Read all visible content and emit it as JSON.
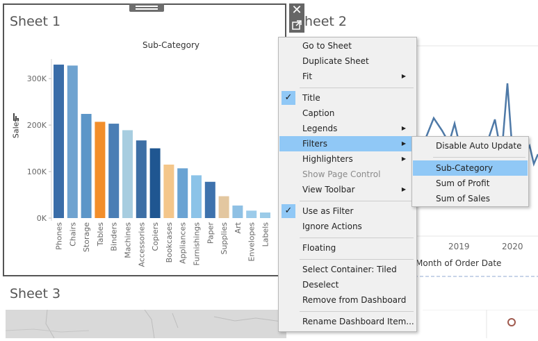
{
  "sheets": {
    "sheet1_title": "Sheet 1",
    "sheet2_title": "Sheet 2",
    "sheet2_title_visible": "heet 2",
    "sheet3_title": "Sheet 3"
  },
  "sheet1_chart": {
    "title": "Sub-Category",
    "ylabel": "Sales"
  },
  "chart_data": {
    "type": "bar",
    "title": "Sub-Category",
    "xlabel": "",
    "ylabel": "Sales",
    "ylim": [
      0,
      345000
    ],
    "yticks": [
      "0K",
      "100K",
      "200K",
      "300K"
    ],
    "categories": [
      "Phones",
      "Chairs",
      "Storage",
      "Tables",
      "Binders",
      "Machines",
      "Accessories",
      "Copiers",
      "Bookcases",
      "Appliances",
      "Furnishings",
      "Paper",
      "Supplies",
      "Art",
      "Envelopes",
      "Labels"
    ],
    "values": [
      330000,
      328000,
      224000,
      207000,
      203000,
      189000,
      167000,
      150000,
      115000,
      107000,
      92000,
      78000,
      47000,
      27000,
      16000,
      12000
    ],
    "colors": [
      "#3a6da8",
      "#6fa3d0",
      "#5c96c8",
      "#f28e2b",
      "#4a7eb5",
      "#a7cde0",
      "#3d6fa5",
      "#1f5691",
      "#f4c68a",
      "#6aa3d3",
      "#8cc3e8",
      "#3e72ad",
      "#e3c7a0",
      "#8ec0e4",
      "#9ccbea",
      "#9bcbe8"
    ],
    "grid": false,
    "legend": "none"
  },
  "sheet2_chart": {
    "xticks": [
      "2019",
      "2020"
    ],
    "xlabel": "Month of Order Date"
  },
  "context_menu": {
    "items": [
      {
        "label": "Go to Sheet"
      },
      {
        "label": "Duplicate Sheet"
      },
      {
        "label": "Fit",
        "submenu": true
      },
      {
        "separator": true
      },
      {
        "label": "Title",
        "checked": true
      },
      {
        "label": "Caption"
      },
      {
        "label": "Legends",
        "submenu": true
      },
      {
        "label": "Filters",
        "submenu": true,
        "highlighted": true
      },
      {
        "label": "Highlighters",
        "submenu": true
      },
      {
        "label": "Show Page Control",
        "disabled": true
      },
      {
        "label": "View Toolbar",
        "submenu": true
      },
      {
        "separator": true
      },
      {
        "label": "Use as Filter",
        "checked": true
      },
      {
        "label": "Ignore Actions"
      },
      {
        "separator": true
      },
      {
        "label": "Floating"
      },
      {
        "separator": true
      },
      {
        "label": "Select Container: Tiled"
      },
      {
        "label": "Deselect"
      },
      {
        "label": "Remove from Dashboard"
      },
      {
        "separator": true
      },
      {
        "label": "Rename Dashboard Item..."
      }
    ]
  },
  "filters_submenu": {
    "items": [
      {
        "label": "Disable Auto Update"
      },
      {
        "separator": true
      },
      {
        "label": "Sub-Category",
        "highlighted": true
      },
      {
        "label": "Sum of Profit"
      },
      {
        "label": "Sum of Sales"
      }
    ]
  },
  "icons": {
    "close": "close-icon",
    "popout": "popout-icon",
    "sort": "sort-icon"
  },
  "colors": {
    "menu_highlight": "#90c8f6",
    "frame_border": "#555555",
    "line_series": "#4e79a7"
  }
}
